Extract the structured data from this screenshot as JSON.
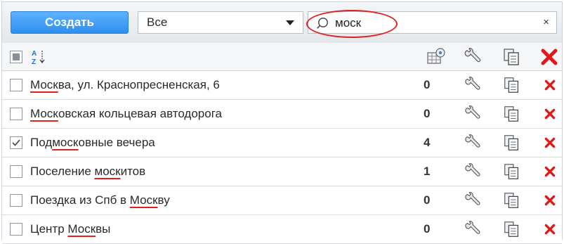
{
  "toolbar": {
    "create_label": "Создать",
    "filter_value": "Все",
    "search_value": "моск",
    "clear_label": "×"
  },
  "colors": {
    "create_button": "#2e8ff0",
    "highlight": "#e02020",
    "delete": "#e01818"
  },
  "header": {
    "select_all_icon": "select-all-checkbox",
    "sort_icon": "sort-az-icon",
    "columns": [
      "database-icon",
      "wrench-icon",
      "copy-icon",
      "delete-icon"
    ]
  },
  "rows": [
    {
      "segments": [
        {
          "text": "Моск",
          "hl": true
        },
        {
          "text": "ва, ул. Краснопресненская, 6",
          "hl": false
        }
      ],
      "count": "0",
      "checked": false
    },
    {
      "segments": [
        {
          "text": "Моск",
          "hl": true
        },
        {
          "text": "овская кольцевая автодорога",
          "hl": false
        }
      ],
      "count": "0",
      "checked": false
    },
    {
      "segments": [
        {
          "text": "Под",
          "hl": false
        },
        {
          "text": "моск",
          "hl": true
        },
        {
          "text": "овные вечера",
          "hl": false
        }
      ],
      "count": "4",
      "checked": true
    },
    {
      "segments": [
        {
          "text": "Поселение ",
          "hl": false
        },
        {
          "text": "моск",
          "hl": true
        },
        {
          "text": "итов",
          "hl": false
        }
      ],
      "count": "1",
      "checked": false
    },
    {
      "segments": [
        {
          "text": "Поездка из Спб в ",
          "hl": false
        },
        {
          "text": "Моск",
          "hl": true
        },
        {
          "text": "ву",
          "hl": false
        }
      ],
      "count": "0",
      "checked": false
    },
    {
      "segments": [
        {
          "text": "Центр ",
          "hl": false
        },
        {
          "text": "Моск",
          "hl": true
        },
        {
          "text": "вы",
          "hl": false
        }
      ],
      "count": "0",
      "checked": false
    }
  ]
}
